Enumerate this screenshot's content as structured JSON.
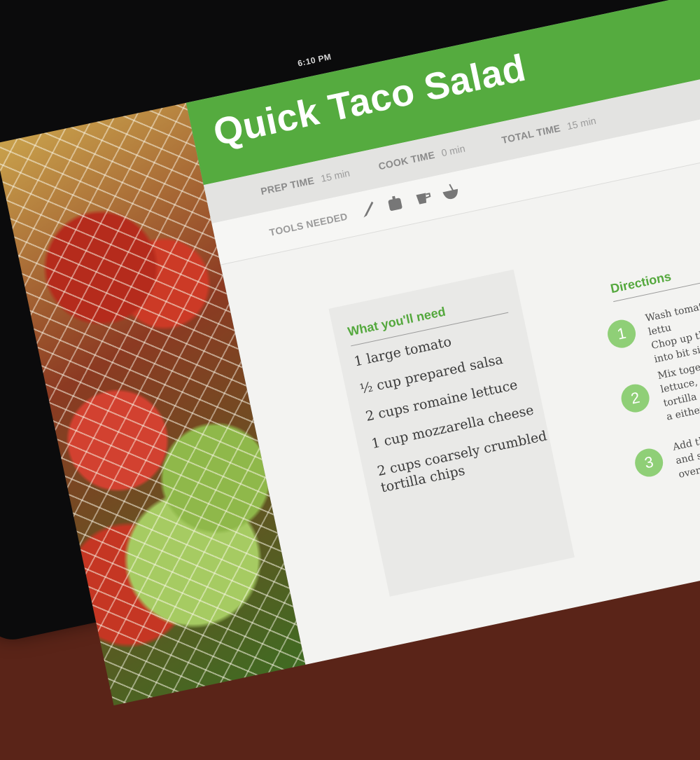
{
  "status_bar": {
    "time": "6:10 PM"
  },
  "recipe": {
    "title": "Quick Taco Salad",
    "times": [
      {
        "label": "PREP TIME",
        "value": "15 min"
      },
      {
        "label": "COOK TIME",
        "value": "0 min"
      },
      {
        "label": "TOTAL TIME",
        "value": "15 min"
      }
    ],
    "tools_label": "TOOLS NEEDED",
    "tools": [
      "knife-icon",
      "cutting-board-icon",
      "measuring-cup-icon",
      "bowl-icon"
    ],
    "ingredients_heading": "What you'll need",
    "ingredients": [
      "1 large tomato",
      "½ cup prepared salsa",
      "2 cups romaine lettuce",
      "1 cup mozzarella cheese",
      "2 cups coarsely crumbled",
      "tortilla chips"
    ],
    "directions_heading": "Directions",
    "steps": [
      {
        "number": "1",
        "lines": [
          "Wash tomato and romaine lettu",
          "Chop up the tomato and lettuc",
          "into bit sized pieces."
        ]
      },
      {
        "number": "2",
        "lines": [
          "Mix together chopped tom",
          "lettuce, and coarsely crum",
          "tortilla chips in a bowl. S",
          "a either a bowl or plate"
        ]
      },
      {
        "number": "3",
        "lines": [
          "Add the ½ cup of pre",
          "and sprinkle mozza",
          "over the top."
        ]
      }
    ]
  },
  "colors": {
    "accent": "#55ab3f",
    "step_circle": "#8fcf77",
    "times_bar": "#e3e3e1"
  }
}
